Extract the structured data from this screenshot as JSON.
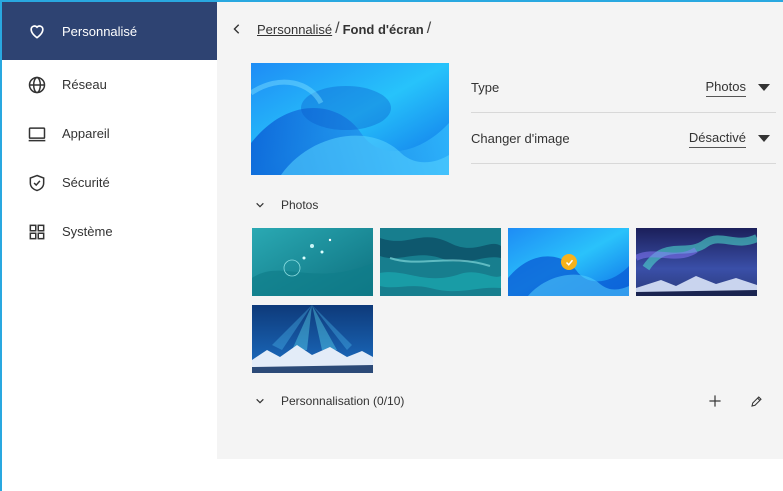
{
  "sidebar": {
    "items": [
      {
        "label": "Personnalisé",
        "icon": "heart-icon",
        "active": true
      },
      {
        "label": "Réseau",
        "icon": "globe-icon"
      },
      {
        "label": "Appareil",
        "icon": "monitor-icon"
      },
      {
        "label": "Sécurité",
        "icon": "shield-check-icon"
      },
      {
        "label": "Système",
        "icon": "grid-icon"
      }
    ]
  },
  "breadcrumb": {
    "parent": "Personnalisé",
    "separator": "/",
    "current": "Fond d'écran"
  },
  "settings": {
    "type_label": "Type",
    "type_value": "Photos",
    "change_label": "Changer d'image",
    "change_value": "Désactivé"
  },
  "photos_section": {
    "title": "Photos",
    "selected_index": 2,
    "thumbnails": [
      "teal-water-bubbles",
      "teal-marble",
      "blue-wave",
      "aurora-mountains",
      "aurora-glacier"
    ]
  },
  "custom_section": {
    "title": "Personnalisation (0/10)"
  },
  "colors": {
    "sidebar_active": "#2e4372",
    "accent_border": "#29a8e0",
    "check": "#f6b21b",
    "main_bg": "#f4f4f4"
  }
}
